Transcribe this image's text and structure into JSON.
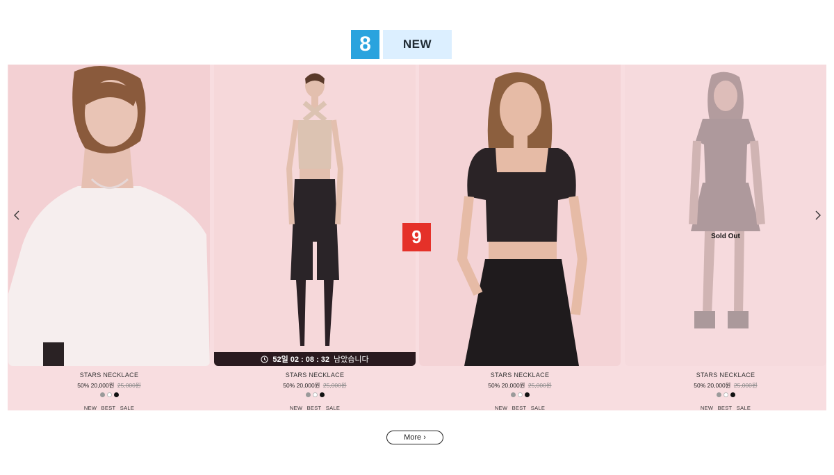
{
  "markers": {
    "section_number": "8",
    "section_label": "NEW",
    "overlay_number": "9"
  },
  "carousel": {
    "prev_icon": "chevron-left-icon",
    "next_icon": "chevron-right-icon"
  },
  "products": [
    {
      "name": "STARS NECKLACE",
      "discount": "50%",
      "price": "20,000원",
      "original_price": "25,000원",
      "swatches": [
        "#9a9a9a",
        "#ffffff",
        "#111111"
      ],
      "badges": [
        "NEW",
        "BEST",
        "SALE"
      ]
    },
    {
      "name": "STARS NECKLACE",
      "discount": "50%",
      "price": "20,000원",
      "original_price": "25,000원",
      "swatches": [
        "#9a9a9a",
        "#ffffff",
        "#111111"
      ],
      "badges": [
        "NEW",
        "BEST",
        "SALE"
      ],
      "timer": {
        "countdown": "52일 02 : 08 : 32",
        "suffix": "남았습니다"
      }
    },
    {
      "name": "STARS NECKLACE",
      "discount": "50%",
      "price": "20,000원",
      "original_price": "25,000원",
      "swatches": [
        "#9a9a9a",
        "#ffffff",
        "#111111"
      ],
      "badges": [
        "NEW",
        "BEST",
        "SALE"
      ]
    },
    {
      "name": "STARS NECKLACE",
      "discount": "50%",
      "price": "20,000원",
      "original_price": "25,000원",
      "swatches": [
        "#9a9a9a",
        "#ffffff",
        "#111111"
      ],
      "badges": [
        "NEW",
        "BEST",
        "SALE"
      ],
      "sold_out": "Sold Out"
    }
  ],
  "more_button": "More ›",
  "colors": {
    "section_bg": "#f8dde0",
    "blue_marker": "#2aa3de",
    "red_marker": "#e53129"
  }
}
